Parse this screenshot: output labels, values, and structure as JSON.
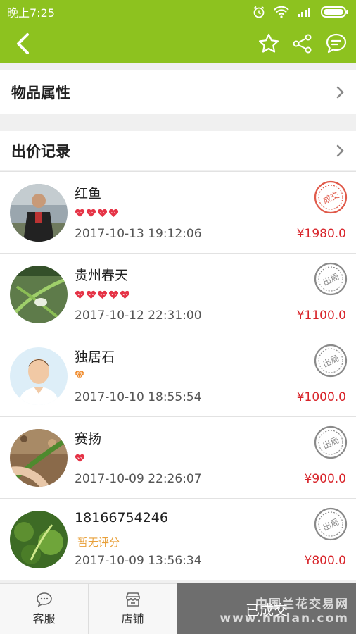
{
  "status_bar": {
    "time": "晚上7:25"
  },
  "sections": {
    "properties_label": "物品属性",
    "bids_label": "出价记录"
  },
  "bids": [
    {
      "name": "红鱼",
      "hearts": 4,
      "rating_text": "",
      "time": "2017-10-13 19:12:06",
      "price": "¥1980.0",
      "stamp": "成交"
    },
    {
      "name": "贵州春天",
      "hearts": 5,
      "rating_text": "",
      "time": "2017-10-12 22:31:00",
      "price": "¥1100.0",
      "stamp": "出局"
    },
    {
      "name": "独居石",
      "hearts": 0,
      "rating_text": "",
      "time": "2017-10-10 18:55:54",
      "price": "¥1000.0",
      "stamp": "出局"
    },
    {
      "name": "赛扬",
      "hearts": 1,
      "rating_text": "",
      "time": "2017-10-09 22:26:07",
      "price": "¥900.0",
      "stamp": "出局"
    },
    {
      "name": "18166754246",
      "hearts": 0,
      "rating_text": "暂无评分",
      "time": "2017-10-09 13:56:34",
      "price": "¥800.0",
      "stamp": "出局"
    }
  ],
  "bottom_bar": {
    "service_label": "客服",
    "shop_label": "店铺",
    "status_label": "已成交",
    "watermark_line1": "中国兰花交易网",
    "watermark_line2": "www.hmlan.com"
  },
  "colors": {
    "brand": "#8dc21f",
    "price": "#d8242a",
    "deal_stamp": "#e05a4a",
    "out_stamp": "#8a8a8a"
  }
}
